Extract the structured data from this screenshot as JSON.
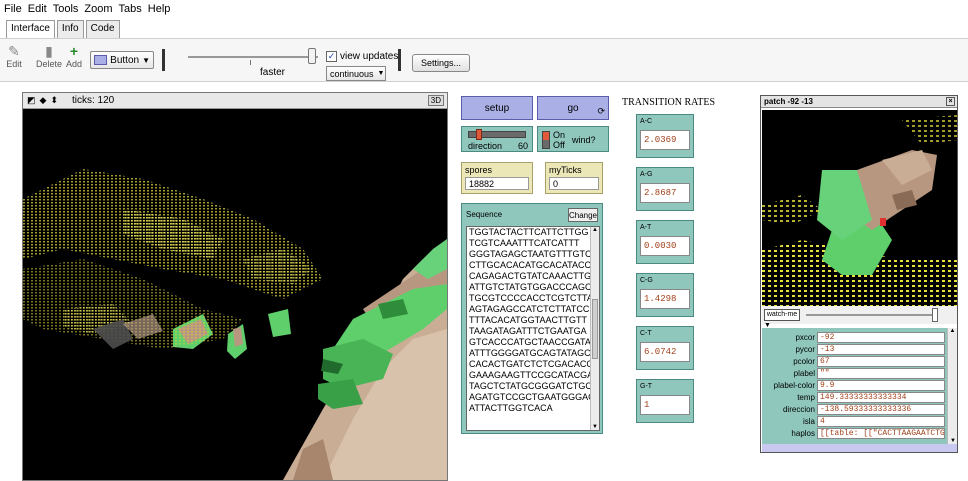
{
  "menu": [
    "File",
    "Edit",
    "Tools",
    "Zoom",
    "Tabs",
    "Help"
  ],
  "tabs": [
    "Interface",
    "Info",
    "Code"
  ],
  "toolbar": {
    "edit_label": "Edit",
    "delete_label": "Delete",
    "add_label": "Add",
    "widget_type": "Button",
    "speed_label": "faster",
    "view_updates_label": "view updates",
    "view_updates_checked": true,
    "update_mode": "continuous",
    "settings_label": "Settings..."
  },
  "view": {
    "ticks_text": "ticks: 120",
    "mode_badge": "3D"
  },
  "buttons": {
    "setup": "setup",
    "go": "go"
  },
  "direction_slider": {
    "label": "direction",
    "value": "60"
  },
  "wind_switch": {
    "on": "On",
    "off": "Off",
    "label": "wind?"
  },
  "spores_monitor": {
    "label": "spores",
    "value": "18882"
  },
  "myticks_monitor": {
    "label": "myTicks",
    "value": "0"
  },
  "sequence": {
    "title": "Sequence",
    "change_label": "Change",
    "lines": [
      "TGGTACTACTTCATTCTTGG",
      "TCGTCAAATTTCATCATTT",
      "GGGTAGAGCTAATGTTTGTC",
      "CTTGCACACATGCACATACC",
      "CAGAGACTGTATCAAACTTG",
      "ATTGTCTATGTGGACCCAGC",
      "TGCGTCCCCACCTCGTCTTA",
      "AGTAGAGCCATCTCTTATCC",
      "TTTACACATGGTAACTTGTT",
      "TAAGATAGATTTCTGAATGA",
      "GTCACCCATGCTAACCGATAC",
      "ATTTGGGGATGCAGTATAGC",
      "CACACTGATCTCTCGACACC",
      "GAAAGAAGTTCCGCATACGA",
      "TAGCTCTATGCGGGATCTGC",
      "AGATGTCCGCTGAATGGGAG",
      "ATTACTTGGTCACA"
    ]
  },
  "transition_rates": {
    "title": "TRANSITION RATES",
    "items": [
      {
        "label": "A-C",
        "value": "2.0369"
      },
      {
        "label": "A-G",
        "value": "2.8687"
      },
      {
        "label": "A-T",
        "value": "0.0030"
      },
      {
        "label": "C-G",
        "value": "1.4298"
      },
      {
        "label": "C-T",
        "value": "6.0742"
      },
      {
        "label": "G-T",
        "value": "1"
      }
    ]
  },
  "inspector": {
    "title": "patch -92 -13",
    "watch_label": "watch-me",
    "props": [
      {
        "key": "pxcor",
        "value": "-92"
      },
      {
        "key": "pycor",
        "value": "-13"
      },
      {
        "key": "pcolor",
        "value": "67"
      },
      {
        "key": "plabel",
        "value": "\"\""
      },
      {
        "key": "plabel-color",
        "value": "9.9"
      },
      {
        "key": "temp",
        "value": "149.33333333333334"
      },
      {
        "key": "direccion",
        "value": "-138.59333333333336"
      },
      {
        "key": "isla",
        "value": "4"
      },
      {
        "key": "haplos",
        "value": "[[table: [[\"CACTTAAGAATCTGTC"
      }
    ]
  },
  "colors": {
    "teal_widget": "#8fc7bd",
    "button": "#aab0e6",
    "monitor": "#ece7b6",
    "value_text": "#a0401a"
  }
}
